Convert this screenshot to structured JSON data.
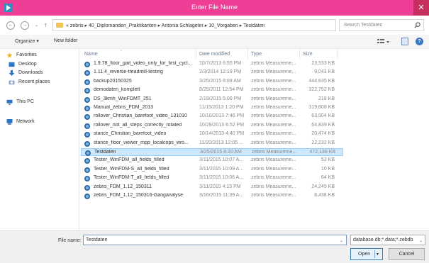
{
  "window": {
    "title": "Enter File Name",
    "close_glyph": "✕",
    "app_icon": "zebris-app-icon",
    "accent": "#ee3e96"
  },
  "nav": {
    "back": "←",
    "forward": "→",
    "recent": "⌄",
    "up": "↑",
    "breadcrumb": "« zebris ▸ 40_Diplomanden_Praktikanten ▸ Antonia Schlageter ▸ 10_Vorgaben ▸ Testdaten",
    "dropdown": "⌄",
    "refresh": "↻",
    "search_placeholder": "Search Testdaten"
  },
  "toolbar": {
    "organize": "Organize ▾",
    "new_folder": "New folder",
    "help": "?"
  },
  "sidebar": {
    "items": [
      {
        "label": "Favorites",
        "icon": "star-icon"
      },
      {
        "label": "Desktop",
        "icon": "desktop-icon"
      },
      {
        "label": "Downloads",
        "icon": "downloads-icon"
      },
      {
        "label": "Recent places",
        "icon": "recent-places-icon"
      },
      {
        "label": "This PC",
        "icon": "computer-icon"
      },
      {
        "label": "Network",
        "icon": "network-icon"
      }
    ]
  },
  "columns": {
    "name": "Name",
    "date": "Date modified",
    "type": "Type",
    "size": "Size"
  },
  "files": [
    {
      "name": "1.9.78_floor_gait_video_only_for_first_cycl...",
      "date": "10/7/2013 6:55 PM",
      "type": "zebris Measureme...",
      "size": "23,533 KB"
    },
    {
      "name": "1.11.4_reverse-treadmill-testing",
      "date": "2/3/2014 12:19 PM",
      "type": "zebris Measureme...",
      "size": "9,043 KB"
    },
    {
      "name": "backup20150325",
      "date": "3/25/2015 8:08 AM",
      "type": "zebris Measureme...",
      "size": "444,635 KB"
    },
    {
      "name": "demodaten_komplett",
      "date": "8/25/2011 12:54 PM",
      "type": "zebris Measureme...",
      "size": "322,752 KB"
    },
    {
      "name": "DS_3kmh_WinFDMT_251",
      "date": "2/19/2015 5:06 PM",
      "type": "zebris Measureme...",
      "size": "218 KB"
    },
    {
      "name": "Manual_zebris_FDM_2013",
      "date": "11/15/2013 1:20 PM",
      "type": "zebris Measureme...",
      "size": "319,608 KB"
    },
    {
      "name": "rollover_Christian_barefoot_video_131010",
      "date": "10/10/2013 7:46 PM",
      "type": "zebris Measureme...",
      "size": "63,504 KB"
    },
    {
      "name": "rollover_not_all_steps_correctly_rotated",
      "date": "10/29/2013 6:52 PM",
      "type": "zebris Measureme...",
      "size": "64,839 KB"
    },
    {
      "name": "stance_Christian_barefoot_video",
      "date": "10/14/2013 4:40 PM",
      "type": "zebris Measureme...",
      "size": "20,474 KB"
    },
    {
      "name": "stance_floor_viewer_mpp_localcops_wro...",
      "date": "11/20/2013 12:05 ...",
      "type": "zebris Measureme...",
      "size": "22,232 KB"
    },
    {
      "name": "Testdaten",
      "date": "3/25/2015 8:20 AM",
      "type": "zebris Measureme...",
      "size": "472,138 KB",
      "selected": true
    },
    {
      "name": "Tester_WinFDM_all_fields_filled",
      "date": "3/11/2015 10:07 A...",
      "type": "zebris Measureme...",
      "size": "52 KB"
    },
    {
      "name": "Tester_WinFDM-S_all_fields_filled",
      "date": "3/11/2015 10:09 A...",
      "type": "zebris Measureme...",
      "size": "10 KB"
    },
    {
      "name": "Tester_WinFDM-T_all_fields_filled",
      "date": "3/11/2015 10:06 A...",
      "type": "zebris Measureme...",
      "size": "64 KB"
    },
    {
      "name": "zebris_FDM_1.12_150311",
      "date": "3/11/2015 4:15 PM",
      "type": "zebris Measureme...",
      "size": "24,245 KB"
    },
    {
      "name": "zebris_FDM_1.12_150316-Ganganalyse",
      "date": "3/16/2015 11:39 A...",
      "type": "zebris Measureme...",
      "size": "8,438 KB"
    }
  ],
  "footer": {
    "file_name_label": "File name:",
    "file_name_value": "Testdaten",
    "file_type_value": "database.db;*.data;*.zebdb",
    "open_label": "Open",
    "cancel_label": "Cancel",
    "dropdown": "⌄",
    "split_arrow": "▾"
  }
}
